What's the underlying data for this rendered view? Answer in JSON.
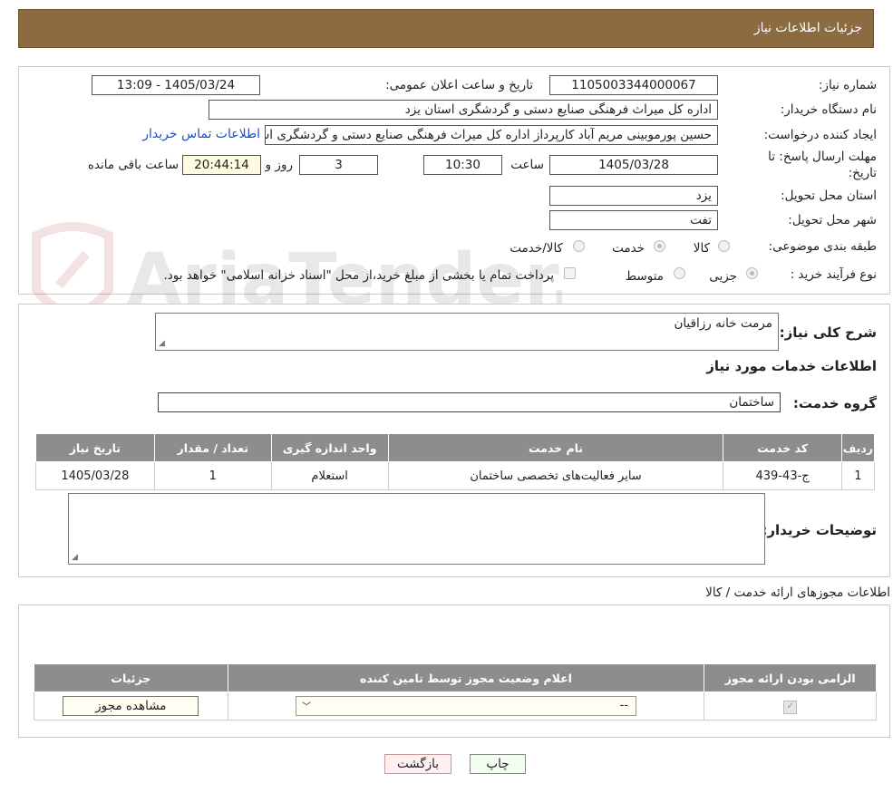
{
  "header": {
    "title": "جزئیات اطلاعات نیاز"
  },
  "form": {
    "need_number_label": "شماره نیاز:",
    "need_number": "1105003344000067",
    "announce_label": "تاریخ و ساعت اعلان عمومی:",
    "announce_value": "1405/03/24 - 13:09",
    "buyer_label": "نام دستگاه خریدار:",
    "buyer_value": "اداره کل میراث فرهنگی  صنایع دستی و گردشگری استان یزد",
    "creator_label": "ایجاد کننده درخواست:",
    "creator_value": "حسین پورموبینی مریم آباد کارپرداز اداره کل میراث فرهنگی  صنایع دستی و گردشگری استان یزد",
    "contact_link": "اطلاعات تماس خریدار",
    "deadline_label_1": "مهلت ارسال پاسخ: تا",
    "deadline_label_2": "تاریخ:",
    "deadline_date": "1405/03/28",
    "time_label": "ساعت",
    "deadline_time": "10:30",
    "days_value": "3",
    "days_label": "روز و",
    "remaining_value": "20:44:14",
    "remaining_label": "ساعت باقی مانده",
    "province_label": "استان محل تحویل:",
    "province_value": "یزد",
    "city_label": "شهر محل تحویل:",
    "city_value": "تفت",
    "category_label": "طبقه بندی موضوعی:",
    "category_options": [
      "کالا",
      "خدمت",
      "کالا/خدمت"
    ],
    "process_label": "نوع فرآیند خرید :",
    "process_options": [
      "جزیی",
      "متوسط"
    ],
    "payment_note": "پرداخت تمام یا بخشی از مبلغ خرید،از محل \"اسناد خزانه اسلامی\" خواهد بود."
  },
  "summary": {
    "label": "شرح کلی نیاز:",
    "value": "مرمت خانه رزاقیان"
  },
  "services": {
    "section_title": "اطلاعات خدمات مورد نیاز",
    "group_label": "گروه خدمت:",
    "group_value": "ساختمان",
    "columns": [
      "ردیف",
      "کد خدمت",
      "نام خدمت",
      "واحد اندازه گیری",
      "تعداد / مقدار",
      "تاریخ نیاز"
    ],
    "rows": [
      {
        "row": "1",
        "code": "ج-43-439",
        "name": "سایر فعالیت‌های تخصصی ساختمان",
        "unit": "استعلام",
        "qty": "1",
        "date": "1405/03/28"
      }
    ]
  },
  "buyer_notes": {
    "label": "توضیحات خریدار:",
    "value": ""
  },
  "permits": {
    "title": "اطلاعات مجوزهای ارائه خدمت / کالا",
    "columns": [
      "الزامی بودن ارائه مجوز",
      "اعلام وضعیت مجوز توسط تامین کننده",
      "جزئیات"
    ],
    "select_value": "--",
    "view_button": "مشاهده مجوز"
  },
  "actions": {
    "print": "چاپ",
    "back": "بازگشت"
  },
  "watermark_text": "AriaTender.neT"
}
